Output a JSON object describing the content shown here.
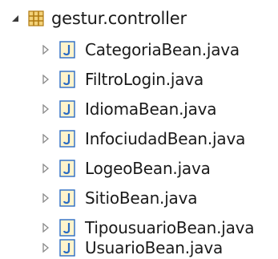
{
  "tree": {
    "package": {
      "name": "gestur.controller",
      "expanded": true,
      "icon": "package-icon"
    },
    "files": [
      {
        "name": "CategoriaBean.java",
        "icon": "java-file-icon"
      },
      {
        "name": "FiltroLogin.java",
        "icon": "java-file-icon"
      },
      {
        "name": "IdiomaBean.java",
        "icon": "java-file-icon"
      },
      {
        "name": "InfociudadBean.java",
        "icon": "java-file-icon"
      },
      {
        "name": "LogeoBean.java",
        "icon": "java-file-icon"
      },
      {
        "name": "SitioBean.java",
        "icon": "java-file-icon"
      },
      {
        "name": "TipousuarioBean.java",
        "icon": "java-file-icon"
      },
      {
        "name": "UsuarioBean.java",
        "icon": "java-file-icon"
      }
    ]
  },
  "colors": {
    "package_icon": "#c0871a",
    "java_icon_blue": "#2a6cc4",
    "java_icon_bg": "#fff4cc",
    "text": "#1a1a1a",
    "toggle": "#8a8a8a",
    "toggle_expanded": "#3a3a3a"
  }
}
